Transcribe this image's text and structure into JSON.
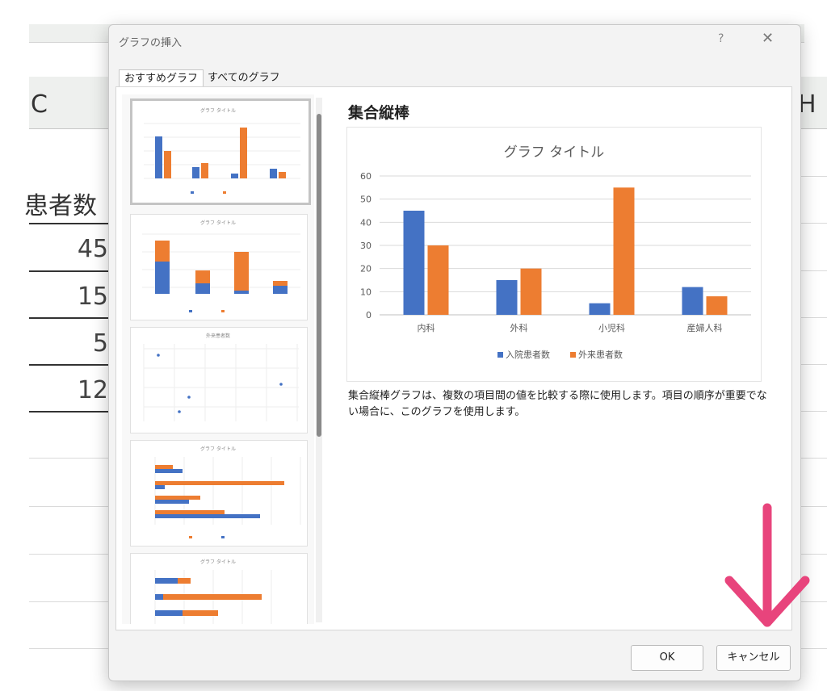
{
  "dialog": {
    "title": "グラフの挿入",
    "help_icon": "?",
    "close_icon": "✕",
    "tabs": [
      {
        "label": "おすすめグラフ",
        "active": true
      },
      {
        "label": "すべてのグラフ",
        "active": false
      }
    ],
    "selected_chart_type": "集合縦棒",
    "description": "集合縦棒グラフは、複数の項目間の値を比較する際に使用します。項目の順序が重要でない場合に、このグラフを使用します。",
    "ok_label": "OK",
    "cancel_label": "キャンセル"
  },
  "background_sheet": {
    "column_c": "C",
    "column_h": "H",
    "header_partial": "患者数",
    "values": [
      "45",
      "15",
      "5",
      "12"
    ]
  },
  "thumbnails": [
    {
      "title": "グラフ タイトル",
      "kind": "clustered-column",
      "selected": true
    },
    {
      "title": "グラフ タイトル",
      "kind": "stacked-column",
      "selected": false
    },
    {
      "title": "外来患者数",
      "kind": "scatter",
      "selected": false
    },
    {
      "title": "グラフ タイトル",
      "kind": "clustered-bar",
      "selected": false
    },
    {
      "title": "グラフ タイトル",
      "kind": "stacked-bar",
      "selected": false
    }
  ],
  "colors": {
    "series1": "#4472c4",
    "series2": "#ed7d31",
    "arrow": "#e8447c"
  },
  "chart_data": {
    "type": "bar",
    "title": "グラフ タイトル",
    "categories": [
      "内科",
      "外科",
      "小児科",
      "産婦人科"
    ],
    "series": [
      {
        "name": "入院患者数",
        "values": [
          45,
          15,
          5,
          12
        ]
      },
      {
        "name": "外来患者数",
        "values": [
          30,
          20,
          55,
          8
        ]
      }
    ],
    "ylim": [
      0,
      60
    ],
    "yticks": [
      "0",
      "10",
      "20",
      "30",
      "40",
      "50",
      "60"
    ],
    "grid": true,
    "legend": "bottom"
  }
}
